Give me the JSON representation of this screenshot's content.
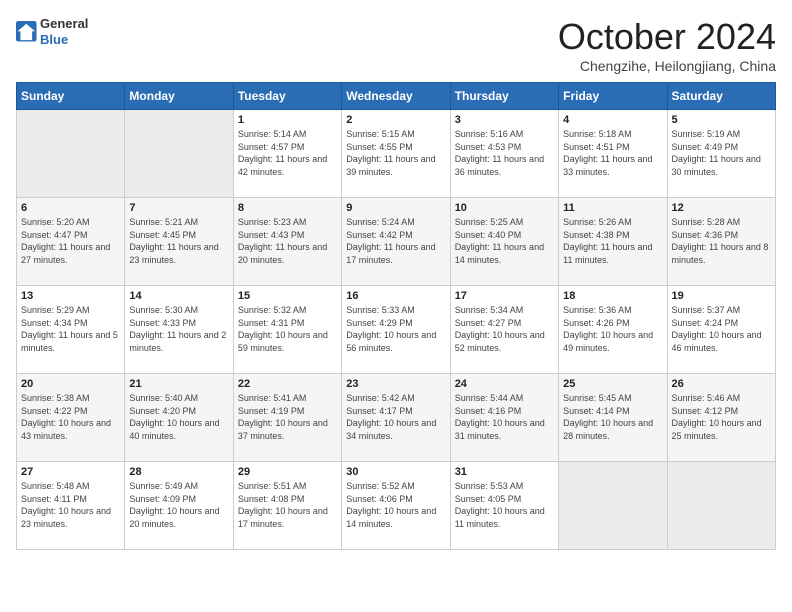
{
  "header": {
    "logo_general": "General",
    "logo_blue": "Blue",
    "title": "October 2024",
    "location": "Chengzihe, Heilongjiang, China"
  },
  "days_of_week": [
    "Sunday",
    "Monday",
    "Tuesday",
    "Wednesday",
    "Thursday",
    "Friday",
    "Saturday"
  ],
  "weeks": [
    [
      {
        "day": "",
        "empty": true
      },
      {
        "day": "",
        "empty": true
      },
      {
        "day": "1",
        "sunrise": "Sunrise: 5:14 AM",
        "sunset": "Sunset: 4:57 PM",
        "daylight": "Daylight: 11 hours and 42 minutes."
      },
      {
        "day": "2",
        "sunrise": "Sunrise: 5:15 AM",
        "sunset": "Sunset: 4:55 PM",
        "daylight": "Daylight: 11 hours and 39 minutes."
      },
      {
        "day": "3",
        "sunrise": "Sunrise: 5:16 AM",
        "sunset": "Sunset: 4:53 PM",
        "daylight": "Daylight: 11 hours and 36 minutes."
      },
      {
        "day": "4",
        "sunrise": "Sunrise: 5:18 AM",
        "sunset": "Sunset: 4:51 PM",
        "daylight": "Daylight: 11 hours and 33 minutes."
      },
      {
        "day": "5",
        "sunrise": "Sunrise: 5:19 AM",
        "sunset": "Sunset: 4:49 PM",
        "daylight": "Daylight: 11 hours and 30 minutes."
      }
    ],
    [
      {
        "day": "6",
        "sunrise": "Sunrise: 5:20 AM",
        "sunset": "Sunset: 4:47 PM",
        "daylight": "Daylight: 11 hours and 27 minutes."
      },
      {
        "day": "7",
        "sunrise": "Sunrise: 5:21 AM",
        "sunset": "Sunset: 4:45 PM",
        "daylight": "Daylight: 11 hours and 23 minutes."
      },
      {
        "day": "8",
        "sunrise": "Sunrise: 5:23 AM",
        "sunset": "Sunset: 4:43 PM",
        "daylight": "Daylight: 11 hours and 20 minutes."
      },
      {
        "day": "9",
        "sunrise": "Sunrise: 5:24 AM",
        "sunset": "Sunset: 4:42 PM",
        "daylight": "Daylight: 11 hours and 17 minutes."
      },
      {
        "day": "10",
        "sunrise": "Sunrise: 5:25 AM",
        "sunset": "Sunset: 4:40 PM",
        "daylight": "Daylight: 11 hours and 14 minutes."
      },
      {
        "day": "11",
        "sunrise": "Sunrise: 5:26 AM",
        "sunset": "Sunset: 4:38 PM",
        "daylight": "Daylight: 11 hours and 11 minutes."
      },
      {
        "day": "12",
        "sunrise": "Sunrise: 5:28 AM",
        "sunset": "Sunset: 4:36 PM",
        "daylight": "Daylight: 11 hours and 8 minutes."
      }
    ],
    [
      {
        "day": "13",
        "sunrise": "Sunrise: 5:29 AM",
        "sunset": "Sunset: 4:34 PM",
        "daylight": "Daylight: 11 hours and 5 minutes."
      },
      {
        "day": "14",
        "sunrise": "Sunrise: 5:30 AM",
        "sunset": "Sunset: 4:33 PM",
        "daylight": "Daylight: 11 hours and 2 minutes."
      },
      {
        "day": "15",
        "sunrise": "Sunrise: 5:32 AM",
        "sunset": "Sunset: 4:31 PM",
        "daylight": "Daylight: 10 hours and 59 minutes."
      },
      {
        "day": "16",
        "sunrise": "Sunrise: 5:33 AM",
        "sunset": "Sunset: 4:29 PM",
        "daylight": "Daylight: 10 hours and 56 minutes."
      },
      {
        "day": "17",
        "sunrise": "Sunrise: 5:34 AM",
        "sunset": "Sunset: 4:27 PM",
        "daylight": "Daylight: 10 hours and 52 minutes."
      },
      {
        "day": "18",
        "sunrise": "Sunrise: 5:36 AM",
        "sunset": "Sunset: 4:26 PM",
        "daylight": "Daylight: 10 hours and 49 minutes."
      },
      {
        "day": "19",
        "sunrise": "Sunrise: 5:37 AM",
        "sunset": "Sunset: 4:24 PM",
        "daylight": "Daylight: 10 hours and 46 minutes."
      }
    ],
    [
      {
        "day": "20",
        "sunrise": "Sunrise: 5:38 AM",
        "sunset": "Sunset: 4:22 PM",
        "daylight": "Daylight: 10 hours and 43 minutes."
      },
      {
        "day": "21",
        "sunrise": "Sunrise: 5:40 AM",
        "sunset": "Sunset: 4:20 PM",
        "daylight": "Daylight: 10 hours and 40 minutes."
      },
      {
        "day": "22",
        "sunrise": "Sunrise: 5:41 AM",
        "sunset": "Sunset: 4:19 PM",
        "daylight": "Daylight: 10 hours and 37 minutes."
      },
      {
        "day": "23",
        "sunrise": "Sunrise: 5:42 AM",
        "sunset": "Sunset: 4:17 PM",
        "daylight": "Daylight: 10 hours and 34 minutes."
      },
      {
        "day": "24",
        "sunrise": "Sunrise: 5:44 AM",
        "sunset": "Sunset: 4:16 PM",
        "daylight": "Daylight: 10 hours and 31 minutes."
      },
      {
        "day": "25",
        "sunrise": "Sunrise: 5:45 AM",
        "sunset": "Sunset: 4:14 PM",
        "daylight": "Daylight: 10 hours and 28 minutes."
      },
      {
        "day": "26",
        "sunrise": "Sunrise: 5:46 AM",
        "sunset": "Sunset: 4:12 PM",
        "daylight": "Daylight: 10 hours and 25 minutes."
      }
    ],
    [
      {
        "day": "27",
        "sunrise": "Sunrise: 5:48 AM",
        "sunset": "Sunset: 4:11 PM",
        "daylight": "Daylight: 10 hours and 23 minutes."
      },
      {
        "day": "28",
        "sunrise": "Sunrise: 5:49 AM",
        "sunset": "Sunset: 4:09 PM",
        "daylight": "Daylight: 10 hours and 20 minutes."
      },
      {
        "day": "29",
        "sunrise": "Sunrise: 5:51 AM",
        "sunset": "Sunset: 4:08 PM",
        "daylight": "Daylight: 10 hours and 17 minutes."
      },
      {
        "day": "30",
        "sunrise": "Sunrise: 5:52 AM",
        "sunset": "Sunset: 4:06 PM",
        "daylight": "Daylight: 10 hours and 14 minutes."
      },
      {
        "day": "31",
        "sunrise": "Sunrise: 5:53 AM",
        "sunset": "Sunset: 4:05 PM",
        "daylight": "Daylight: 10 hours and 11 minutes."
      },
      {
        "day": "",
        "empty": true
      },
      {
        "day": "",
        "empty": true
      }
    ]
  ]
}
